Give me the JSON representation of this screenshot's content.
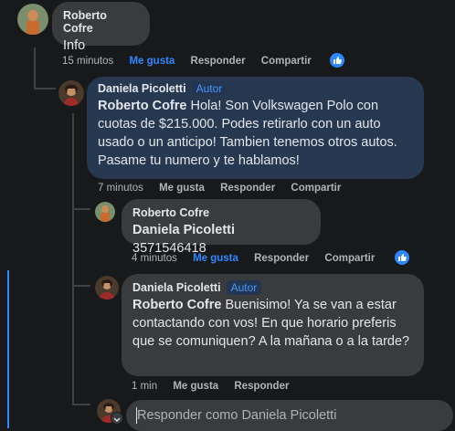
{
  "comments": [
    {
      "author": "Roberto Cofre",
      "text": "Info",
      "time": "15 minutos",
      "like": "Me gusta",
      "reply": "Responder",
      "share": "Compartir"
    },
    {
      "author": "Daniela Picoletti",
      "badge": "Autor",
      "mention": "Roberto Cofre",
      "text": " Hola! Son Volkswagen Polo con cuotas de $215.000. Podes retirarlo con un auto usado o un anticipo! Tambien tenemos otros autos. Pasame tu numero y te hablamos!",
      "time": "7 minutos",
      "like": "Me gusta",
      "reply": "Responder",
      "share": "Compartir"
    },
    {
      "author": "Roberto Cofre",
      "mention": "Daniela Picoletti",
      "text": " 3571546418",
      "time": "4 minutos",
      "like": "Me gusta",
      "reply": "Responder",
      "share": "Compartir"
    },
    {
      "author": "Daniela Picoletti",
      "badge": "Autor",
      "mention": "Roberto Cofre",
      "text": " Buenisimo! Ya se van a estar contactando con vos! En que horario preferis que se comuniquen? A la mañana o a la tarde?",
      "time": "1 min",
      "like": "Me gusta",
      "reply": "Responder"
    }
  ],
  "reply_box": {
    "placeholder": "Responder como Daniela Picoletti"
  },
  "colors": {
    "background": "#18191a",
    "bubble": "#3a3b3c",
    "highlight_bubble": "#263951",
    "accent": "#2d88ff",
    "badge": "#4599ff"
  }
}
